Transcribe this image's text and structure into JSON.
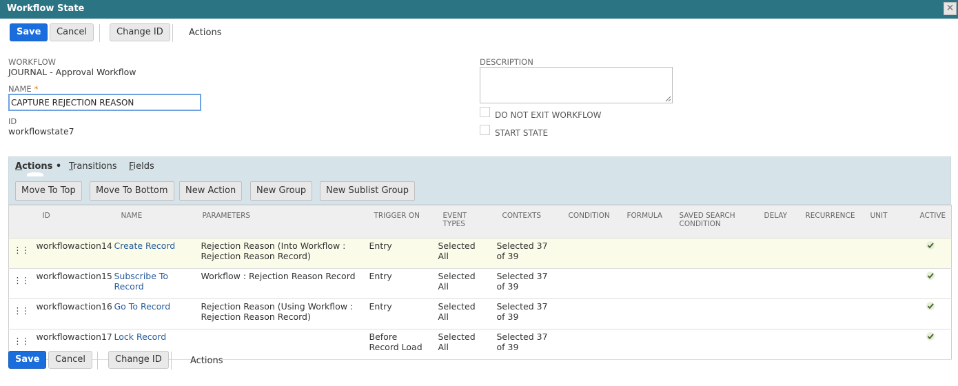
{
  "window": {
    "title": "Workflow State",
    "close_symbol": "✕"
  },
  "toolbar": {
    "save": "Save",
    "cancel": "Cancel",
    "change_id": "Change ID",
    "actions": "Actions"
  },
  "form": {
    "workflow_label": "WORKFLOW",
    "workflow_value": "JOURNAL - Approval Workflow",
    "name_label": "NAME",
    "required_mark": "*",
    "name_value": "CAPTURE REJECTION REASON",
    "id_label": "ID",
    "id_value": "workflowstate7",
    "description_label": "DESCRIPTION",
    "description_value": "",
    "do_not_exit_label": "DO NOT EXIT WORKFLOW",
    "do_not_exit_checked": false,
    "start_state_label": "START STATE",
    "start_state_checked": false
  },
  "subtabs": {
    "tabs": [
      {
        "first": "A",
        "rest": "ctions",
        "suffix": " •",
        "active": true
      },
      {
        "first": "T",
        "rest": "ransitions",
        "suffix": "",
        "active": false
      },
      {
        "first": "F",
        "rest": "ields",
        "suffix": "",
        "active": false
      }
    ],
    "buttons": [
      "Move To Top",
      "Move To Bottom",
      "New Action",
      "New Group",
      "New Sublist Group"
    ]
  },
  "grid": {
    "columns": [
      "",
      "ID",
      "NAME",
      "PARAMETERS",
      "TRIGGER ON",
      "EVENT TYPES",
      "CONTEXTS",
      "CONDITION",
      "FORMULA",
      "SAVED SEARCH CONDITION",
      "DELAY",
      "RECURRENCE",
      "UNIT",
      "ACTIVE"
    ],
    "drag_glyph": "⋮⋮",
    "rows": [
      {
        "id": "workflowaction14",
        "name": "Create Record",
        "parameters": "Rejection Reason (Into Workflow : Rejection Reason Record)",
        "trigger_on": "Entry",
        "event_types": "Selected All",
        "contexts": "Selected 37 of 39",
        "condition": "",
        "formula": "",
        "saved_search": "",
        "delay": "",
        "recurrence": "",
        "unit": "",
        "active": true
      },
      {
        "id": "workflowaction15",
        "name": "Subscribe To Record",
        "parameters": "Workflow : Rejection Reason Record",
        "trigger_on": "Entry",
        "event_types": "Selected All",
        "contexts": "Selected 37 of 39",
        "condition": "",
        "formula": "",
        "saved_search": "",
        "delay": "",
        "recurrence": "",
        "unit": "",
        "active": true
      },
      {
        "id": "workflowaction16",
        "name": "Go To Record",
        "parameters": "Rejection Reason (Using Workflow : Rejection Reason Record)",
        "trigger_on": "Entry",
        "event_types": "Selected All",
        "contexts": "Selected 37 of 39",
        "condition": "",
        "formula": "",
        "saved_search": "",
        "delay": "",
        "recurrence": "",
        "unit": "",
        "active": true
      },
      {
        "id": "workflowaction17",
        "name": "Lock Record",
        "parameters": "",
        "trigger_on": "Before Record Load",
        "event_types": "Selected All",
        "contexts": "Selected 37 of 39",
        "condition": "",
        "formula": "",
        "saved_search": "",
        "delay": "",
        "recurrence": "",
        "unit": "",
        "active": true
      }
    ]
  },
  "colors": {
    "titlebar": "#2a7484",
    "primary_button": "#1a6ddc",
    "link": "#255b9c",
    "highlight_row": "#fbfbe9"
  }
}
